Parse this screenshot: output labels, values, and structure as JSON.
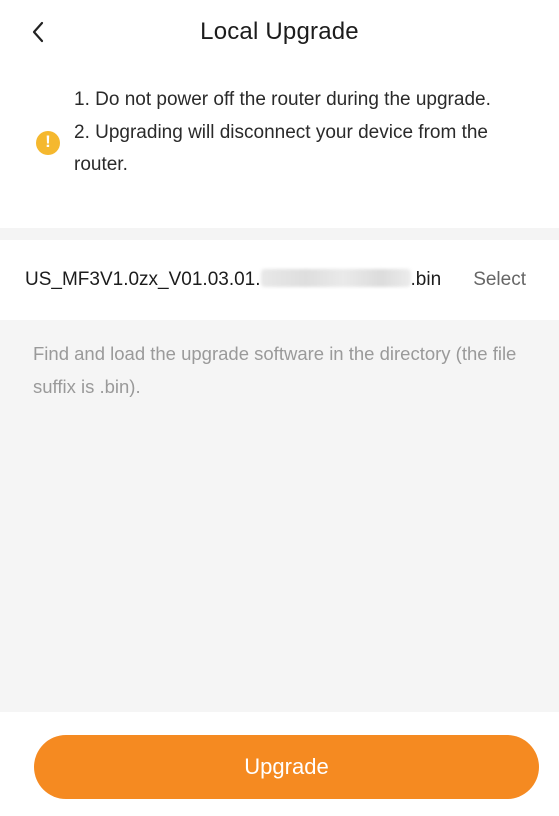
{
  "header": {
    "title": "Local Upgrade",
    "back_icon": "chevron-left-icon"
  },
  "notice": {
    "icon": "warning-icon",
    "icon_glyph": "!",
    "icon_color": "#f5b82e",
    "lines": [
      "1. Do not power off the router during the upgrade.",
      "2. Upgrading will disconnect your device from the router."
    ]
  },
  "file": {
    "name_prefix": "US_MF3V1.0zx_V01.03.01.",
    "name_suffix": ".bin",
    "select_label": "Select"
  },
  "hint": "Find and load the upgrade software in the directory (the file suffix is .bin).",
  "footer": {
    "upgrade_label": "Upgrade",
    "button_color": "#f58a21"
  }
}
